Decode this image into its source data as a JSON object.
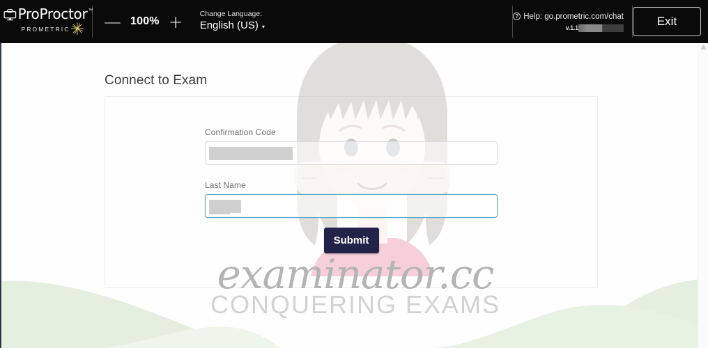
{
  "header": {
    "logo": {
      "name": "ProProctor",
      "tm": "™",
      "sub": "PROMETRIC",
      "monitor_icon": "monitor-icon",
      "starburst_icon": "starburst-icon"
    },
    "zoom": {
      "minus": "—",
      "value": "100%",
      "plus": "+"
    },
    "language": {
      "label": "Change Language:",
      "value": "English (US)",
      "caret": "▾"
    },
    "help": {
      "icon": "?",
      "text": "Help: go.prometric.com/chat",
      "version_prefix": "v.1.1",
      "version_redacted": true
    },
    "exit_label": "Exit"
  },
  "main": {
    "page_title": "Connect to Exam",
    "fields": [
      {
        "label": "Confirmation Code",
        "name": "confirmation-code",
        "value": "",
        "redacted": true,
        "focused": false
      },
      {
        "label": "Last Name",
        "name": "last-name",
        "value": "",
        "redacted": true,
        "focused": true
      }
    ],
    "submit_label": "Submit"
  },
  "watermark": {
    "primary": "examinator.cc",
    "secondary": "CONQUERING EXAMS",
    "avatar_icon": "avatar-illustration"
  },
  "colors": {
    "header_bg": "#0a0a0a",
    "submit_bg": "#23234a",
    "focus_border": "#5aa8c2",
    "hill_green": "#e2eedd",
    "watermark_gray": "#b4b4b4"
  }
}
